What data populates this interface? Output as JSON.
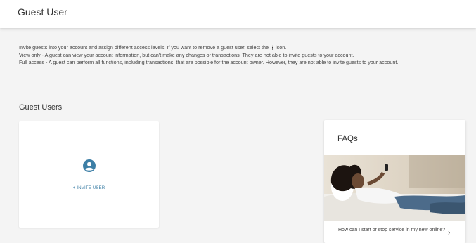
{
  "header": {
    "title": "Guest User"
  },
  "intro": {
    "line1_before": "Invite guests into your account and assign different access levels. If you want to remove a guest user, select the",
    "kebab_icon": "more-vertical-icon",
    "line1_after": "icon.",
    "view_only": "View only - A guest can view your account information, but can't make any changes or transactions. They are not able to invite guests to your account.",
    "full_access": "Full access - A guest can perform all functions, including transactions, that are possible for the account owner. However, they are not able to invite guests to your account."
  },
  "guest_users": {
    "title": "Guest Users",
    "icon": "account-circle-icon",
    "invite_icon": "plus-icon",
    "invite_label": "INVITE USER"
  },
  "faqs": {
    "title": "FAQs",
    "question": "How can I start or stop service in my new online?",
    "chevron": "›"
  },
  "colors": {
    "accent": "#3d7fa6",
    "background": "#f4f4f4"
  }
}
